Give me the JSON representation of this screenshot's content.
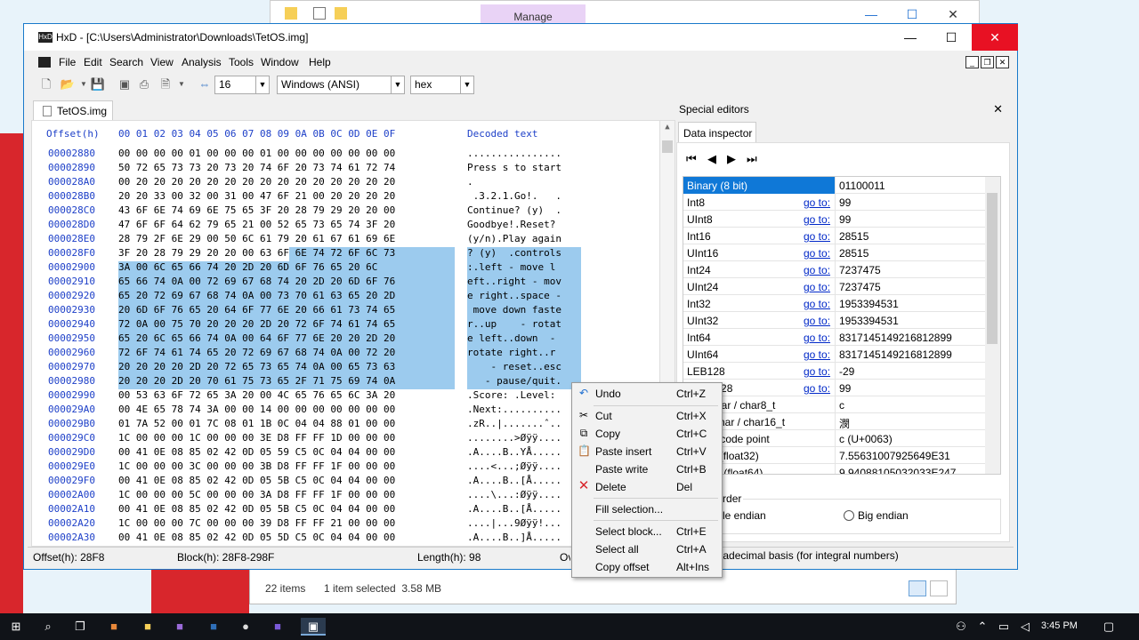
{
  "background": {
    "manage_label": "Manage",
    "explorer_status": {
      "items": "22 items",
      "selected": "1 item selected  3.58 MB"
    }
  },
  "window": {
    "title": "HxD - [C:\\Users\\Administrator\\Downloads\\TetOS.img]",
    "minimize": "—",
    "maximize": "☐",
    "close": "✕"
  },
  "menu": [
    "File",
    "Edit",
    "Search",
    "View",
    "Analysis",
    "Tools",
    "Window",
    "Help"
  ],
  "toolbar": {
    "bytes_per_row": "16",
    "charset": "Windows (ANSI)",
    "offset_base": "hex"
  },
  "tab": "TetOS.img",
  "hex": {
    "header_offset": "Offset(h)",
    "header_cols": "00 01 02 03 04 05 06 07 08 09 0A 0B 0C 0D 0E 0F",
    "header_decoded": "Decoded text",
    "rows": [
      {
        "off": "00002880",
        "hex": "00 00 00 00 01 00 00 00 01 00 00 00 00 00 00 00",
        "dec": "................"
      },
      {
        "off": "00002890",
        "hex": "50 72 65 73 73 20 73 20 74 6F 20 73 74 61 72 74",
        "dec": "Press s to start"
      },
      {
        "off": "000028A0",
        "hex": "00 20 20 20 20 20 20 20 20 20 20 20 20 20 20 20",
        "dec": "."
      },
      {
        "off": "000028B0",
        "hex": "20 20 33 00 32 00 31 00 47 6F 21 00 20 20 20 20",
        "dec": " .3.2.1.Go!.   ."
      },
      {
        "off": "000028C0",
        "hex": "43 6F 6E 74 69 6E 75 65 3F 20 28 79 29 20 20 00",
        "dec": "Continue? (y)  ."
      },
      {
        "off": "000028D0",
        "hex": "47 6F 6F 64 62 79 65 21 00 52 65 73 65 74 3F 20",
        "dec": "Goodbye!.Reset? "
      },
      {
        "off": "000028E0",
        "hex": "28 79 2F 6E 29 00 50 6C 61 79 20 61 67 61 69 6E",
        "dec": "(y/n).Play again"
      },
      {
        "off": "000028F0",
        "hex": "3F 20 28 79 29 20 20 00 63 6F 6E 74 72 6F 6C 73",
        "dec": "? (y)  .controls"
      },
      {
        "off": "00002900",
        "hex": "3A 00 6C 65 66 74 20 2D 20 6D 6F 76 65 20 6C",
        "dec": ":.left - move l"
      },
      {
        "off": "00002910",
        "hex": "65 66 74 0A 00 72 69 67 68 74 20 2D 20 6D 6F 76",
        "dec": "eft..right - mov"
      },
      {
        "off": "00002920",
        "hex": "65 20 72 69 67 68 74 0A 00 73 70 61 63 65 20 2D",
        "dec": "e right..space -"
      },
      {
        "off": "00002930",
        "hex": "20 6D 6F 76 65 20 64 6F 77 6E 20 66 61 73 74 65",
        "dec": " move down faste"
      },
      {
        "off": "00002940",
        "hex": "72 0A 00 75 70 20 20 20 2D 20 72 6F 74 61 74 65",
        "dec": "r..up    - rotat"
      },
      {
        "off": "00002950",
        "hex": "65 20 6C 65 66 74 0A 00 64 6F 77 6E 20 20 2D 20",
        "dec": "e left..down  - "
      },
      {
        "off": "00002960",
        "hex": "72 6F 74 61 74 65 20 72 69 67 68 74 0A 00 72 20",
        "dec": "rotate right..r "
      },
      {
        "off": "00002970",
        "hex": "20 20 20 20 2D 20 72 65 73 65 74 0A 00 65 73 63",
        "dec": "    - reset..esc"
      },
      {
        "off": "00002980",
        "hex": "20 20 20 2D 20 70 61 75 73 65 2F 71 75 69 74 0A",
        "dec": "   - pause/quit."
      },
      {
        "off": "00002990",
        "hex": "00 53 63 6F 72 65 3A 20 00 4C 65 76 65 6C 3A 20",
        "dec": ".Score: .Level:"
      },
      {
        "off": "000029A0",
        "hex": "00 4E 65 78 74 3A 00 00 14 00 00 00 00 00 00 00",
        "dec": ".Next:.........."
      },
      {
        "off": "000029B0",
        "hex": "01 7A 52 00 01 7C 08 01 1B 0C 04 04 88 01 00 00",
        "dec": ".zR..|.......ˆ.."
      },
      {
        "off": "000029C0",
        "hex": "1C 00 00 00 1C 00 00 00 3E D8 FF FF 1D 00 00 00",
        "dec": "........>Øÿÿ...."
      },
      {
        "off": "000029D0",
        "hex": "00 41 0E 08 85 02 42 0D 05 59 C5 0C 04 04 00 00",
        "dec": ".A....B..YÅ....."
      },
      {
        "off": "000029E0",
        "hex": "1C 00 00 00 3C 00 00 00 3B D8 FF FF 1F 00 00 00",
        "dec": "....<...;Øÿÿ...."
      },
      {
        "off": "000029F0",
        "hex": "00 41 0E 08 85 02 42 0D 05 5B C5 0C 04 04 00 00",
        "dec": ".A....B..[Å....."
      },
      {
        "off": "00002A00",
        "hex": "1C 00 00 00 5C 00 00 00 3A D8 FF FF 1F 00 00 00",
        "dec": "....\\...:Øÿÿ...."
      },
      {
        "off": "00002A10",
        "hex": "00 41 0E 08 85 02 42 0D 05 5B C5 0C 04 04 00 00",
        "dec": ".A....B..[Å....."
      },
      {
        "off": "00002A20",
        "hex": "1C 00 00 00 7C 00 00 00 39 D8 FF FF 21 00 00 00",
        "dec": "....|...9Øÿÿ!..."
      },
      {
        "off": "00002A30",
        "hex": "00 41 0E 08 85 02 42 0D 05 5D C5 0C 04 04 00 00",
        "dec": ".A....B..]Å....."
      }
    ]
  },
  "special_editors": {
    "title": "Special editors",
    "tab": "Data inspector",
    "rows": [
      {
        "name": "Binary (8 bit)",
        "goto": "",
        "value": "01100011"
      },
      {
        "name": "Int8",
        "goto": "go to:",
        "value": "99"
      },
      {
        "name": "UInt8",
        "goto": "go to:",
        "value": "99"
      },
      {
        "name": "Int16",
        "goto": "go to:",
        "value": "28515"
      },
      {
        "name": "UInt16",
        "goto": "go to:",
        "value": "28515"
      },
      {
        "name": "Int24",
        "goto": "go to:",
        "value": "7237475"
      },
      {
        "name": "UInt24",
        "goto": "go to:",
        "value": "7237475"
      },
      {
        "name": "Int32",
        "goto": "go to:",
        "value": "1953394531"
      },
      {
        "name": "UInt32",
        "goto": "go to:",
        "value": "1953394531"
      },
      {
        "name": "Int64",
        "goto": "go to:",
        "value": "8317145149216812899"
      },
      {
        "name": "UInt64",
        "goto": "go to:",
        "value": "8317145149216812899"
      },
      {
        "name": "LEB128",
        "goto": "go to:",
        "value": "-29"
      },
      {
        "name": "ULEB128",
        "goto": "go to:",
        "value": "99"
      },
      {
        "name": "AnsiChar / char8_t",
        "goto": "",
        "value": "c"
      },
      {
        "name": "WideChar / char16_t",
        "goto": "",
        "value": "潣"
      },
      {
        "name": "UTF-8 code point",
        "goto": "",
        "value": "c (U+0063)"
      },
      {
        "name": "Single (float32)",
        "goto": "",
        "value": "7.55631007925649E31"
      },
      {
        "name": "Double (float64)",
        "goto": "",
        "value": "9.94088105032033E247"
      }
    ],
    "byte_order_label": "Byte order",
    "little_endian": "Little endian",
    "big_endian": "Big endian",
    "hex_basis": "Hexadecimal basis (for integral numbers)"
  },
  "status": {
    "offset": "Offset(h): 28F8",
    "block": "Block(h): 28F8-298F",
    "length": "Length(h): 98",
    "mode": "Overwrite"
  },
  "context_menu": [
    {
      "label": "Undo",
      "shortcut": "Ctrl+Z"
    },
    {
      "label": "Cut",
      "shortcut": "Ctrl+X"
    },
    {
      "label": "Copy",
      "shortcut": "Ctrl+C"
    },
    {
      "label": "Paste insert",
      "shortcut": "Ctrl+V"
    },
    {
      "label": "Paste write",
      "shortcut": "Ctrl+B"
    },
    {
      "label": "Delete",
      "shortcut": "Del"
    },
    {
      "label": "Fill selection...",
      "shortcut": ""
    },
    {
      "label": "Select block...",
      "shortcut": "Ctrl+E"
    },
    {
      "label": "Select all",
      "shortcut": "Ctrl+A"
    },
    {
      "label": "Copy offset",
      "shortcut": "Alt+Ins"
    }
  ],
  "tray": {
    "time": "3:45 PM"
  }
}
